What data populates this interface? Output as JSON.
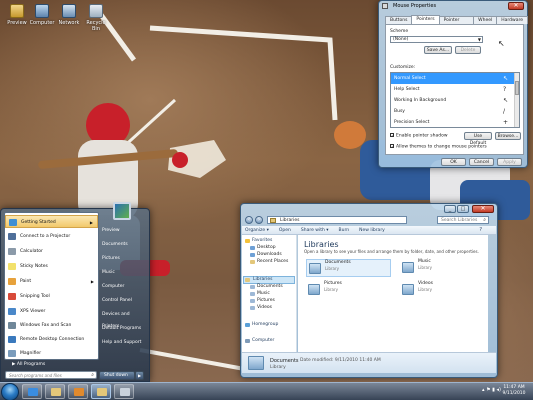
{
  "desktop": {
    "icons": [
      {
        "label": "Preview"
      },
      {
        "label": "Computer"
      },
      {
        "label": "Network"
      },
      {
        "label": "Recycle Bin"
      }
    ]
  },
  "mouse_properties": {
    "title": "Mouse Properties",
    "tabs": [
      "Buttons",
      "Pointers",
      "Pointer Options",
      "Wheel",
      "Hardware"
    ],
    "active_tab": "Pointers",
    "scheme_label": "Scheme",
    "scheme_value": "(None)",
    "save_as_label": "Save As...",
    "delete_label": "Delete",
    "customize_label": "Customize:",
    "cursors": [
      {
        "label": "Normal Select",
        "glyph": "arrow-icon"
      },
      {
        "label": "Help Select",
        "glyph": "help-arrow-icon"
      },
      {
        "label": "Working In Background",
        "glyph": "busy-arrow-icon"
      },
      {
        "label": "Busy",
        "glyph": "busy-icon"
      },
      {
        "label": "Precision Select",
        "glyph": "crosshair-icon"
      }
    ],
    "enable_shadow_label": "Enable pointer shadow",
    "use_default_label": "Use Default",
    "browse_label": "Browse...",
    "allow_themes_label": "Allow themes to change mouse pointers",
    "ok_label": "OK",
    "cancel_label": "Cancel",
    "apply_label": "Apply"
  },
  "explorer": {
    "address": "Libraries",
    "search_placeholder": "Search Libraries",
    "toolbar": [
      "Organize ▾",
      "Open",
      "Share with ▾",
      "Burn",
      "New library"
    ],
    "nav": {
      "favorites": "Favorites",
      "favorite_items": [
        "Desktop",
        "Downloads",
        "Recent Places"
      ],
      "libraries": "Libraries",
      "library_items": [
        "Documents",
        "Music",
        "Pictures",
        "Videos"
      ],
      "homegroup": "Homegroup",
      "computer": "Computer"
    },
    "main": {
      "title": "Libraries",
      "subtitle": "Open a library to see your files and arrange them by folder, date, and other properties.",
      "items": [
        {
          "name": "Documents",
          "type": "Library"
        },
        {
          "name": "Music",
          "type": "Library"
        },
        {
          "name": "Pictures",
          "type": "Library"
        },
        {
          "name": "Videos",
          "type": "Library"
        }
      ]
    },
    "details": {
      "name": "Documents",
      "modified": "Date modified: 9/11/2010 11:40 AM",
      "type": "Library"
    }
  },
  "start_menu": {
    "left_items": [
      {
        "label": "Getting Started",
        "has_arrow": true
      },
      {
        "label": "Connect to a Projector",
        "has_arrow": false
      },
      {
        "label": "Calculator",
        "has_arrow": false
      },
      {
        "label": "Sticky Notes",
        "has_arrow": false
      },
      {
        "label": "Paint",
        "has_arrow": true
      },
      {
        "label": "Snipping Tool",
        "has_arrow": false
      },
      {
        "label": "XPS Viewer",
        "has_arrow": false
      },
      {
        "label": "Windows Fax and Scan",
        "has_arrow": false
      },
      {
        "label": "Remote Desktop Connection",
        "has_arrow": false
      },
      {
        "label": "Magnifier",
        "has_arrow": false
      }
    ],
    "all_programs": "All Programs",
    "search_placeholder": "Search programs and files",
    "right_items": [
      "Preview",
      "Documents",
      "Pictures",
      "Music",
      "Computer",
      "Control Panel",
      "Devices and Printers",
      "Default Programs",
      "Help and Support"
    ],
    "shutdown_label": "Shut down"
  },
  "taskbar": {
    "time": "11:47 AM",
    "date": "9/11/2010"
  }
}
